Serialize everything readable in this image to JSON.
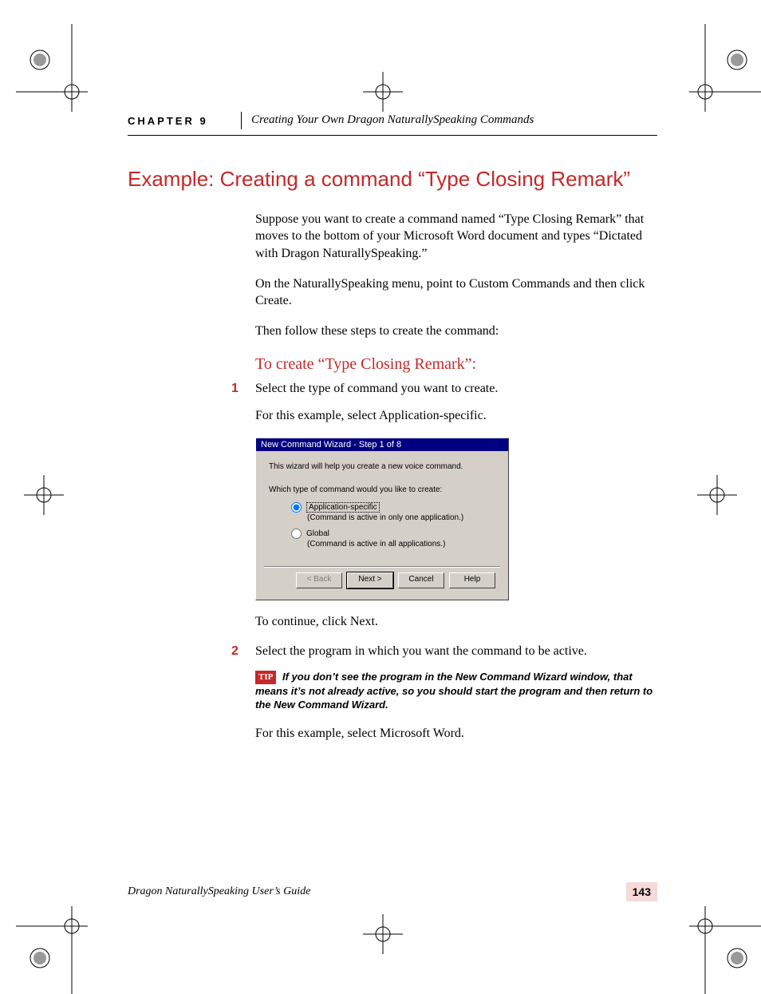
{
  "header": {
    "chapter": "CHAPTER 9",
    "title": "Creating Your Own Dragon NaturallySpeaking Commands"
  },
  "section_title": "Example: Creating a command “Type Closing Remark”",
  "body": {
    "p1": "Suppose you want to create a command named “Type Closing Remark” that moves to the bottom of your Microsoft Word document and types “Dictated with Dragon NaturallySpeaking.”",
    "p2": "On the NaturallySpeaking menu, point to Custom Commands and then click Create.",
    "p3": "Then follow these steps to create the command:"
  },
  "subhead": "To create “Type Closing Remark”:",
  "steps": {
    "one_num": "1",
    "one_text": "Select the type of command you want to create.",
    "one_sub": "For this example, select Application-specific.",
    "two_num": "2",
    "two_text": "Select the program in which you want the command to be active.",
    "two_sub": "For this example, select Microsoft Word.",
    "continue": "To continue, click Next."
  },
  "dialog": {
    "title": "New Command Wizard - Step 1 of 8",
    "intro": "This wizard will help you create a new voice command.",
    "question": "Which type of command would you like to create:",
    "opt1_label": "Application-specific",
    "opt1_desc": "(Command is active in only one application.)",
    "opt2_label": "Global",
    "opt2_desc": "(Command is active in all applications.)",
    "btn_back": "< Back",
    "btn_next": "Next >",
    "btn_cancel": "Cancel",
    "btn_help": "Help"
  },
  "tip": {
    "badge": "TIP",
    "text": "If you don’t see the program in the New Command Wizard window, that means it’s not already active, so you should start the program and then return to the New Command Wizard."
  },
  "footer": {
    "guide": "Dragon NaturallySpeaking User’s Guide",
    "page": "143"
  }
}
